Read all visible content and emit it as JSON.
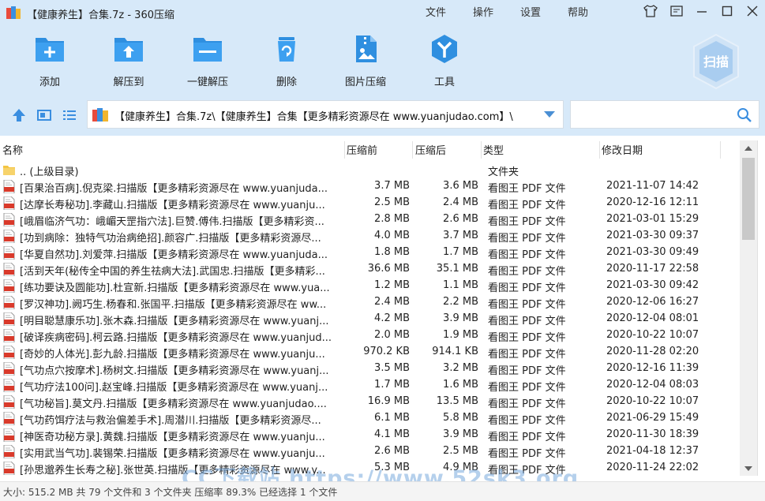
{
  "window": {
    "title": "【健康养生】合集.7z - 360压缩",
    "menu": [
      "文件",
      "操作",
      "设置",
      "帮助"
    ]
  },
  "toolbar": [
    {
      "label": "添加",
      "icon": "add-icon"
    },
    {
      "label": "解压到",
      "icon": "extract-to-icon"
    },
    {
      "label": "一键解压",
      "icon": "one-click-extract-icon"
    },
    {
      "label": "删除",
      "icon": "delete-icon"
    },
    {
      "label": "图片压缩",
      "icon": "image-compress-icon"
    },
    {
      "label": "工具",
      "icon": "tools-icon"
    }
  ],
  "scan": {
    "label": "扫描"
  },
  "path": {
    "value": "【健康养生】合集.7z\\【健康养生】合集【更多精彩资源尽在 www.yuanjudao.com】\\"
  },
  "search": {
    "placeholder": ""
  },
  "columns": {
    "name": "名称",
    "size": "压缩前",
    "compressed": "压缩后",
    "type": "类型",
    "modified": "修改日期"
  },
  "files": [
    {
      "name": ".. (上级目录)",
      "size": "",
      "compressed": "",
      "type": "文件夹",
      "date": "",
      "kind": "folder"
    },
    {
      "name": "[百果治百病].倪克梁.扫描版【更多精彩资源尽在 www.yuanjuda...",
      "size": "3.7 MB",
      "compressed": "3.6 MB",
      "type": "看图王 PDF 文件",
      "date": "2021-11-07 14:42",
      "kind": "pdf"
    },
    {
      "name": "[达摩长寿秘功].李藏山.扫描版【更多精彩资源尽在 www.yuanju...",
      "size": "2.5 MB",
      "compressed": "2.4 MB",
      "type": "看图王 PDF 文件",
      "date": "2020-12-16 12:11",
      "kind": "pdf"
    },
    {
      "name": "[峨眉临济气功：峨嵋天罡指穴法].巨赞.傅伟.扫描版【更多精彩资...",
      "size": "2.8 MB",
      "compressed": "2.6 MB",
      "type": "看图王 PDF 文件",
      "date": "2021-03-01 15:29",
      "kind": "pdf"
    },
    {
      "name": "[功到病除：独特气功治病绝招].颜容广.扫描版【更多精彩资源尽...",
      "size": "4.0 MB",
      "compressed": "3.7 MB",
      "type": "看图王 PDF 文件",
      "date": "2021-03-30 09:37",
      "kind": "pdf"
    },
    {
      "name": "[华夏自然功].刘爱萍.扫描版【更多精彩资源尽在 www.yuanjuda...",
      "size": "1.8 MB",
      "compressed": "1.7 MB",
      "type": "看图王 PDF 文件",
      "date": "2021-03-30 09:49",
      "kind": "pdf"
    },
    {
      "name": "[活到天年(秘传全中国的养生祛病大法].武国忠.扫描版【更多精彩...",
      "size": "36.6 MB",
      "compressed": "35.1 MB",
      "type": "看图王 PDF 文件",
      "date": "2020-11-17 22:58",
      "kind": "pdf"
    },
    {
      "name": "[练功要诀及圆能功].杜宣新.扫描版【更多精彩资源尽在 www.yua...",
      "size": "1.2 MB",
      "compressed": "1.1 MB",
      "type": "看图王 PDF 文件",
      "date": "2021-03-30 09:42",
      "kind": "pdf"
    },
    {
      "name": "[罗汉神功].阙巧生.杨春和.张国平.扫描版【更多精彩资源尽在 ww...",
      "size": "2.4 MB",
      "compressed": "2.2 MB",
      "type": "看图王 PDF 文件",
      "date": "2020-12-06 16:27",
      "kind": "pdf"
    },
    {
      "name": "[明目聪慧康乐功].张木森.扫描版【更多精彩资源尽在 www.yuanj...",
      "size": "4.2 MB",
      "compressed": "3.9 MB",
      "type": "看图王 PDF 文件",
      "date": "2020-12-04 08:01",
      "kind": "pdf"
    },
    {
      "name": "[破译疾病密码].柯云路.扫描版【更多精彩资源尽在 www.yuanjud...",
      "size": "2.0 MB",
      "compressed": "1.9 MB",
      "type": "看图王 PDF 文件",
      "date": "2020-10-22 10:07",
      "kind": "pdf"
    },
    {
      "name": "[奇妙的人体光].彭九龄.扫描版【更多精彩资源尽在 www.yuanju...",
      "size": "970.2 KB",
      "compressed": "914.1 KB",
      "type": "看图王 PDF 文件",
      "date": "2020-11-28 02:20",
      "kind": "pdf"
    },
    {
      "name": "[气功点穴按摩术].杨树文.扫描版【更多精彩资源尽在 www.yuanj...",
      "size": "3.5 MB",
      "compressed": "3.2 MB",
      "type": "看图王 PDF 文件",
      "date": "2020-12-16 11:39",
      "kind": "pdf"
    },
    {
      "name": "[气功疗法100问].赵宝峰.扫描版【更多精彩资源尽在 www.yuanj...",
      "size": "1.7 MB",
      "compressed": "1.6 MB",
      "type": "看图王 PDF 文件",
      "date": "2020-12-04 08:03",
      "kind": "pdf"
    },
    {
      "name": "[气功秘旨].莫文丹.扫描版【更多精彩资源尽在 www.yuanjudao....",
      "size": "16.9 MB",
      "compressed": "13.5 MB",
      "type": "看图王 PDF 文件",
      "date": "2020-10-22 10:07",
      "kind": "pdf"
    },
    {
      "name": "[气功药饵疗法与救治偏差手术].周潜川.扫描版【更多精彩资源尽...",
      "size": "6.1 MB",
      "compressed": "5.8 MB",
      "type": "看图王 PDF 文件",
      "date": "2021-06-29 15:49",
      "kind": "pdf"
    },
    {
      "name": "[神医奇功秘方录].黄魏.扫描版【更多精彩资源尽在 www.yuanju...",
      "size": "4.1 MB",
      "compressed": "3.9 MB",
      "type": "看图王 PDF 文件",
      "date": "2020-11-30 18:39",
      "kind": "pdf"
    },
    {
      "name": "[实用武当气功].裴锡荣.扫描版【更多精彩资源尽在 www.yuanju...",
      "size": "2.6 MB",
      "compressed": "2.5 MB",
      "type": "看图王 PDF 文件",
      "date": "2021-04-18 12:37",
      "kind": "pdf"
    },
    {
      "name": "[孙思邈养生长寿之秘].张世英.扫描版【更多精彩资源尽在 www.y...",
      "size": "5.3 MB",
      "compressed": "4.9 MB",
      "type": "看图王 PDF 文件",
      "date": "2020-11-24 22:02",
      "kind": "pdf"
    }
  ],
  "status": {
    "text": "大小: 515.2 MB 共 79 个文件和 3 个文件夹 压缩率 89.3% 已经选择 1 个文件"
  },
  "watermark": {
    "text": "CC下载站 https://www.52sk3.org"
  },
  "colors": {
    "band": "#d7e9f9",
    "accent": "#2f8fe0",
    "pdf": "#d93a2b",
    "folder": "#f4c542"
  }
}
